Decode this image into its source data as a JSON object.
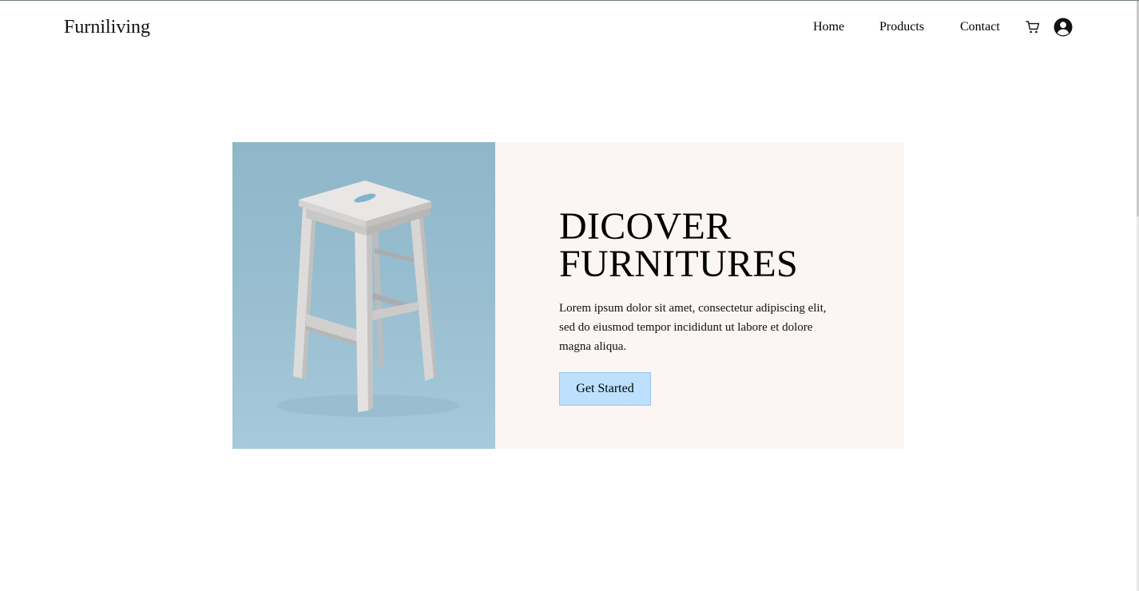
{
  "header": {
    "brand": "Furniliving",
    "nav": {
      "home": "Home",
      "products": "Products",
      "contact": "Contact"
    },
    "icons": {
      "cart": "cart-icon",
      "account": "user-circle-icon"
    }
  },
  "hero": {
    "title_line1": "DICOVER",
    "title_line2": "FURNITURES",
    "description": "Lorem ipsum dolor sit amet, consectetur adipiscing elit, sed do eiusmod tempor incididunt ut labore et dolore magna aliqua.",
    "cta_label": "Get Started"
  },
  "colors": {
    "image_background": "#99bfd1",
    "panel_background": "#fbf6f4",
    "cta_background": "#bde0fe"
  }
}
